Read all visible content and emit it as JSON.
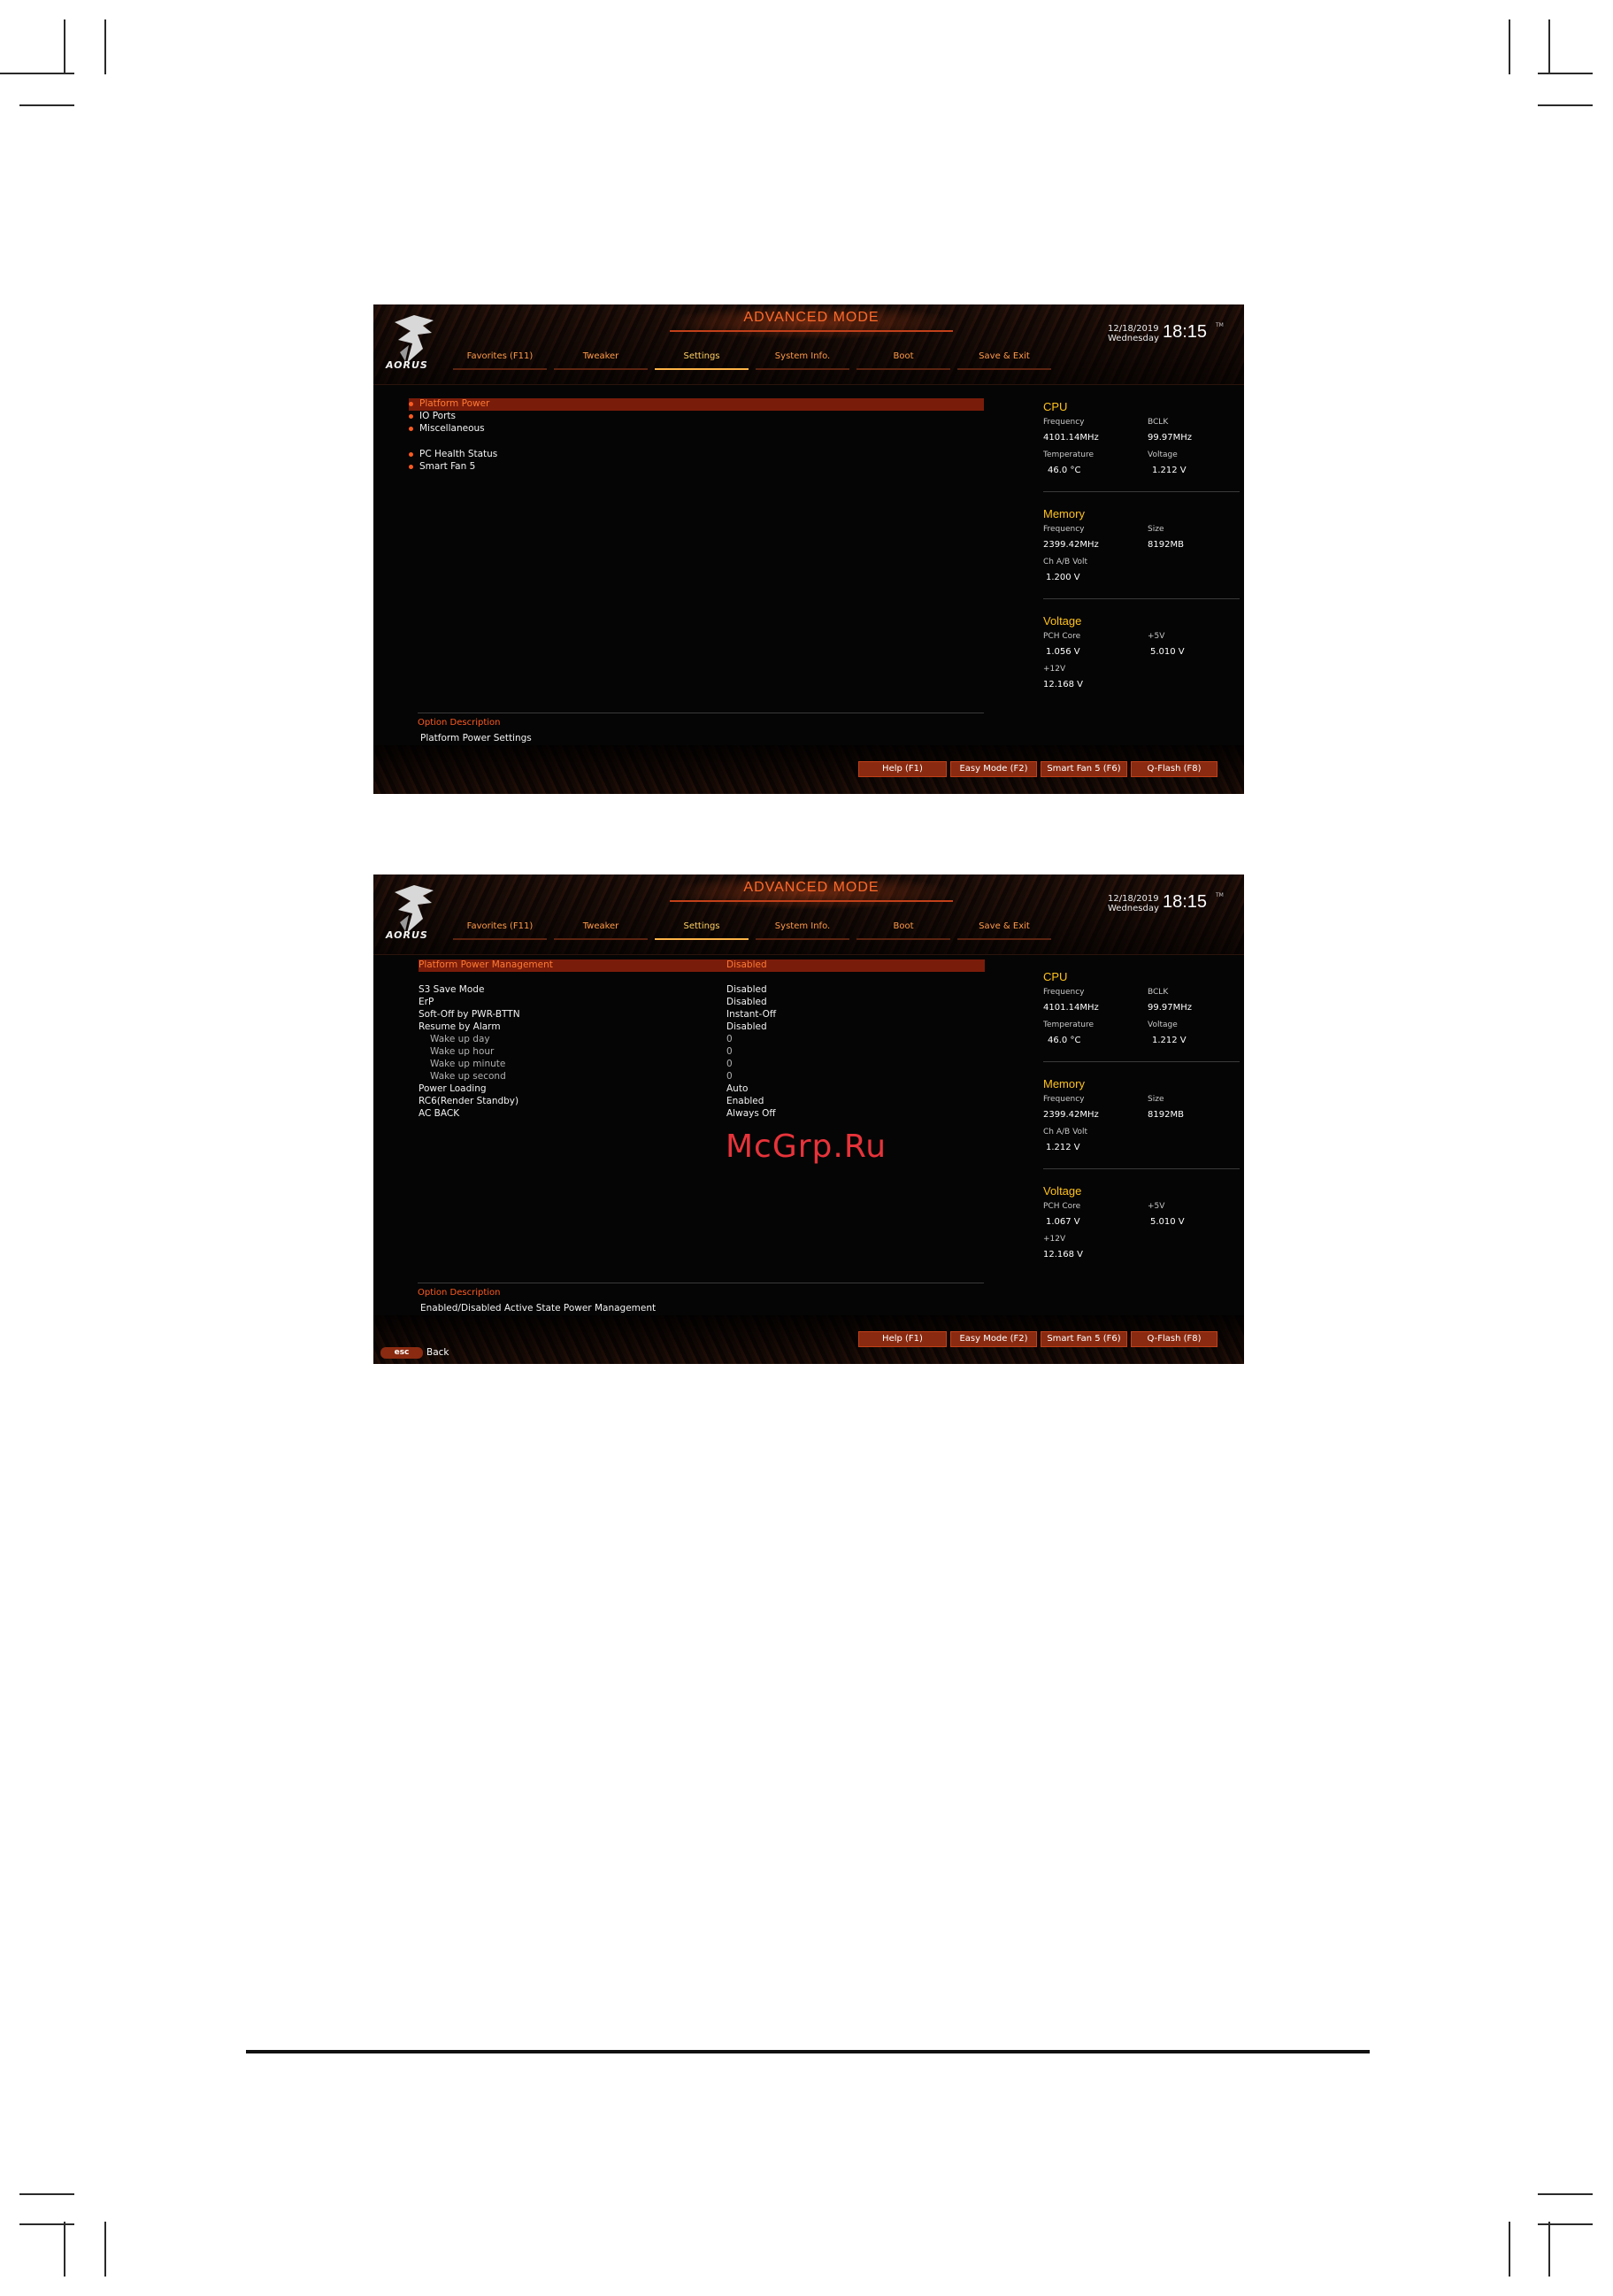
{
  "watermark": "McGrp.Ru",
  "common": {
    "mode_title": "ADVANCED MODE",
    "logo_text": "AORUS",
    "date": "12/18/2019",
    "day": "Wednesday",
    "time": "18:15",
    "tm_mark": "TM",
    "tabs": [
      "Favorites (F11)",
      "Tweaker",
      "Settings",
      "System Info.",
      "Boot",
      "Save & Exit"
    ],
    "active_tab": "Settings",
    "option_description_title": "Option Description",
    "function_buttons": [
      "Help (F1)",
      "Easy Mode (F2)",
      "Smart Fan 5 (F6)",
      "Q-Flash (F8)"
    ],
    "panel": {
      "cpu_title": "CPU",
      "frequency_label": "Frequency",
      "bclk_label": "BCLK",
      "temperature_label": "Temperature",
      "voltage_label": "Voltage",
      "memory_title": "Memory",
      "mem_frequency_label": "Frequency",
      "size_label": "Size",
      "chab_label": "Ch A/B Volt",
      "voltage_title": "Voltage",
      "pch_label": "PCH Core",
      "plus5_label": "+5V",
      "plus12_label": "+12V"
    },
    "colors": {
      "accent": "#ff5a1f",
      "highlight": "#7a1c0a",
      "panel_title": "#ffc21a"
    }
  },
  "screen1": {
    "menu": [
      {
        "label": "Platform Power",
        "highlighted": true
      },
      {
        "label": "IO Ports",
        "highlighted": false
      },
      {
        "label": "Miscellaneous",
        "highlighted": false
      },
      {
        "label": "PC Health Status",
        "highlighted": false
      },
      {
        "label": "Smart Fan 5",
        "highlighted": false
      }
    ],
    "description": "Platform Power Settings",
    "panel_values": {
      "cpu_frequency": "4101.14MHz",
      "bclk": "99.97MHz",
      "temperature": "46.0 °C",
      "voltage": "1.212 V",
      "mem_frequency": "2399.42MHz",
      "size": "8192MB",
      "chab": "1.200 V",
      "pch": "1.056 V",
      "plus5": "5.010 V",
      "plus12": "12.168 V"
    }
  },
  "screen2": {
    "header_row": {
      "label": "Platform Power Management",
      "value": "Disabled"
    },
    "rows": [
      {
        "label": "S3 Save Mode",
        "value": "Disabled",
        "sub": false
      },
      {
        "label": "ErP",
        "value": "Disabled",
        "sub": false
      },
      {
        "label": "Soft-Off by PWR-BTTN",
        "value": "Instant-Off",
        "sub": false
      },
      {
        "label": "Resume by Alarm",
        "value": "Disabled",
        "sub": false
      },
      {
        "label": "Wake up day",
        "value": "0",
        "sub": true
      },
      {
        "label": "Wake up hour",
        "value": "0",
        "sub": true
      },
      {
        "label": "Wake up minute",
        "value": "0",
        "sub": true
      },
      {
        "label": "Wake up second",
        "value": "0",
        "sub": true
      },
      {
        "label": "Power Loading",
        "value": "Auto",
        "sub": false
      },
      {
        "label": "RC6(Render Standby)",
        "value": "Enabled",
        "sub": false
      },
      {
        "label": "AC BACK",
        "value": "Always Off",
        "sub": false
      }
    ],
    "description": "Enabled/Disabled Active State Power Management",
    "esc_label": "esc",
    "back_label": "Back",
    "panel_values": {
      "cpu_frequency": "4101.14MHz",
      "bclk": "99.97MHz",
      "temperature": "46.0 °C",
      "voltage": "1.212 V",
      "mem_frequency": "2399.42MHz",
      "size": "8192MB",
      "chab": "1.212 V",
      "pch": "1.067 V",
      "plus5": "5.010 V",
      "plus12": "12.168 V"
    }
  }
}
